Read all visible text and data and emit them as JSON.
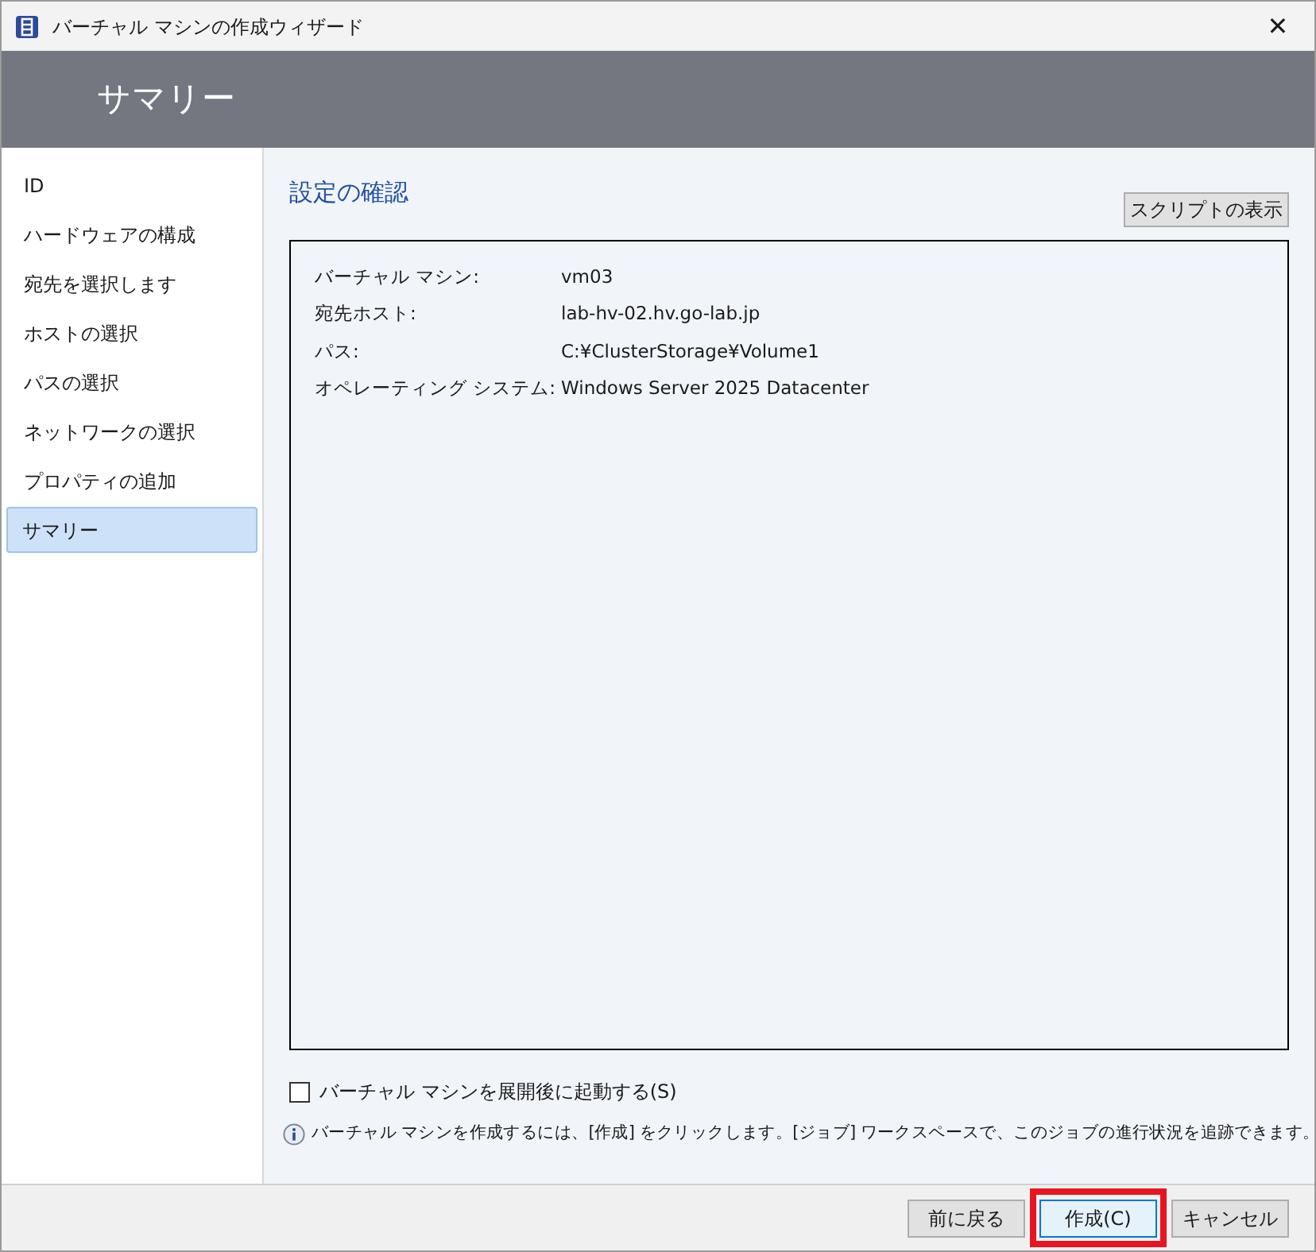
{
  "window": {
    "title": "バーチャル マシンの作成ウィザード",
    "close": "✕"
  },
  "header": {
    "title": "サマリー"
  },
  "sidebar": {
    "items": [
      {
        "label": "ID",
        "selected": false
      },
      {
        "label": "ハードウェアの構成",
        "selected": false
      },
      {
        "label": "宛先を選択します",
        "selected": false
      },
      {
        "label": "ホストの選択",
        "selected": false
      },
      {
        "label": "パスの選択",
        "selected": false
      },
      {
        "label": "ネットワークの選択",
        "selected": false
      },
      {
        "label": "プロパティの追加",
        "selected": false
      },
      {
        "label": "サマリー",
        "selected": true
      }
    ]
  },
  "content": {
    "heading": "設定の確認",
    "script_button": "スクリプトの表示",
    "summary": [
      {
        "label": "バーチャル マシン:",
        "value": "vm03"
      },
      {
        "label": "宛先ホスト:",
        "value": "lab-hv-02.hv.go-lab.jp"
      },
      {
        "label": "パス:",
        "value": "C:¥ClusterStorage¥Volume1"
      },
      {
        "label": "オペレーティング システム:",
        "value": "Windows Server 2025 Datacenter"
      }
    ],
    "start_checkbox": {
      "label": "バーチャル マシンを展開後に起動する(S)",
      "checked": false
    },
    "info": "バーチャル マシンを作成するには、[作成] をクリックします。[ジョブ] ワークスペースで、このジョブの進行状況を追跡できます。"
  },
  "buttons": [
    {
      "label": "前に戻る",
      "highlighted": false,
      "focused": false
    },
    {
      "label": "作成(C)",
      "highlighted": true,
      "focused": true
    },
    {
      "label": "キャンセル",
      "highlighted": false,
      "focused": false
    }
  ]
}
